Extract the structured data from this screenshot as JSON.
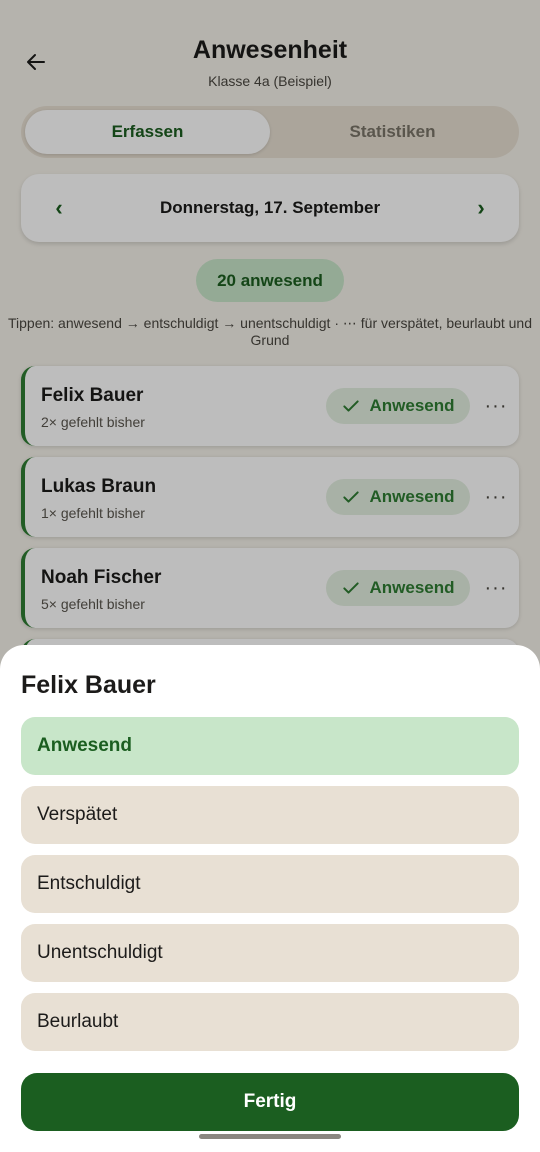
{
  "header": {
    "title": "Anwesenheit",
    "subtitle": "Klasse 4a (Beispiel)"
  },
  "tabs": [
    {
      "label": "Erfassen",
      "active": true
    },
    {
      "label": "Statistiken",
      "active": false
    }
  ],
  "date_nav": {
    "prev": "‹",
    "next": "›",
    "date": "Donnerstag, 17. September"
  },
  "summary_badge": "20 anwesend",
  "hint": "Tippen: anwesend → entschuldigt → unentschuldigt · ⋯ für verspätet, beurlaubt und Grund",
  "students": [
    {
      "name": "Felix Bauer",
      "meta": "2× gefehlt bisher",
      "status": "Anwesend"
    },
    {
      "name": "Lukas Braun",
      "meta": "1× gefehlt bisher",
      "status": "Anwesend"
    },
    {
      "name": "Noah Fischer",
      "meta": "5× gefehlt bisher",
      "status": "Anwesend"
    }
  ],
  "more_glyph": "···",
  "sheet": {
    "title": "Felix Bauer",
    "options": [
      "Anwesend",
      "Verspätet",
      "Entschuldigt",
      "Unentschuldigt",
      "Beurlaubt"
    ],
    "selected": "Anwesend",
    "done_label": "Fertig"
  },
  "colors": {
    "accent": "#1b5e20",
    "present": "#2e7d32",
    "selected_bg": "#c8e6c9",
    "option_bg": "#e8e0d4",
    "background": "#f5f2ea"
  },
  "icons": {
    "back": "arrow-left-icon",
    "status": "check-icon",
    "more": "more-horizontal-icon"
  }
}
